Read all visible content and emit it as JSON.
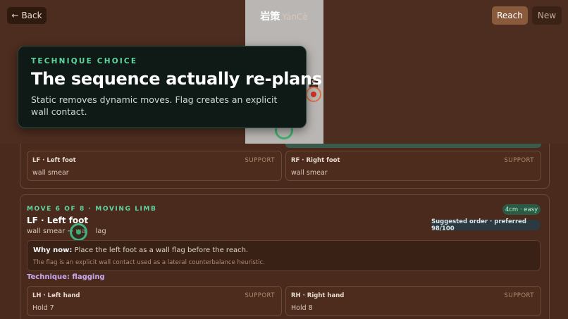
{
  "header": {
    "back_label": "Back",
    "back_icon": "arrow-left-icon",
    "title": "岩策",
    "subtitle": "YánCè",
    "reach_label": "Reach",
    "new_label": "New"
  },
  "wall": {
    "hold_number": "5"
  },
  "tooltip": {
    "eyebrow": "TECHNIQUE CHOICE",
    "title": "The sequence actually re-plans",
    "body": "Static removes dynamic moves. Flag creates an explicit wall contact."
  },
  "previous_move": {
    "limbs": [
      {
        "name": "LF · Left foot",
        "role": "SUPPORT",
        "value": "wall smear"
      },
      {
        "name": "RF · Right foot",
        "role": "SUPPORT",
        "value": "wall smear"
      }
    ]
  },
  "move": {
    "eyebrow": "MOVE 6 OF 8 · MOVING LIMB",
    "title": "LF · Left foot",
    "sub_from": "wall smear →",
    "sub_to_a": "wa",
    "sub_to_b": "lag",
    "difficulty": "4cm · easy",
    "order": "Suggested order · preferred 98/100",
    "why_label": "Why now:",
    "why_text": " Place the left foot as a wall flag before the reach.",
    "why_note": "The flag is an explicit wall contact used as a lateral counterbalance heuristic.",
    "technique": "Technique: flagging",
    "limbs": [
      {
        "name": "LH · Left hand",
        "role": "SUPPORT",
        "value": "Hold 7"
      },
      {
        "name": "RH · Right hand",
        "role": "SUPPORT",
        "value": "Hold 8"
      }
    ]
  },
  "colors": {
    "accent_green": "#5fd6a0",
    "technique_purple": "#c8a8f0",
    "reach_button": "#8a5a3c"
  }
}
